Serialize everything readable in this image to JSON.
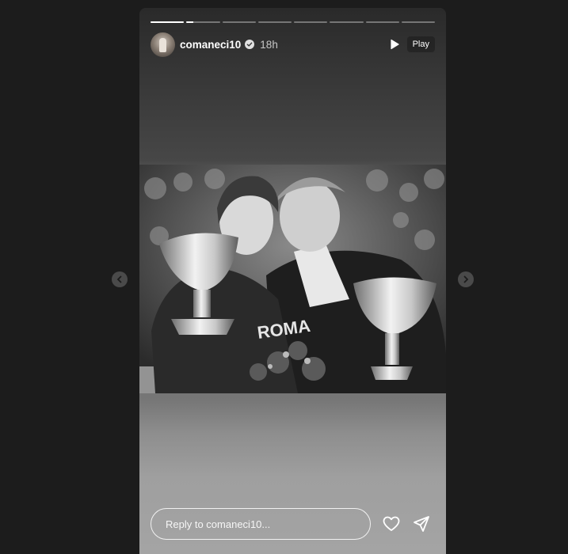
{
  "story": {
    "username": "comaneci10",
    "time": "18h",
    "play_label": "Play",
    "reply_placeholder": "Reply to comaneci10...",
    "segment_count": 8,
    "current_segment": 2,
    "current_segment_progress": 0.2,
    "photo_text": "ROMA"
  },
  "icons": {
    "verified": "verified-badge-icon",
    "play": "play-icon",
    "like": "heart-icon",
    "share": "send-icon",
    "prev": "chevron-left-icon",
    "next": "chevron-right-icon"
  },
  "colors": {
    "page_bg": "#1c1c1c",
    "text": "#ffffff"
  }
}
